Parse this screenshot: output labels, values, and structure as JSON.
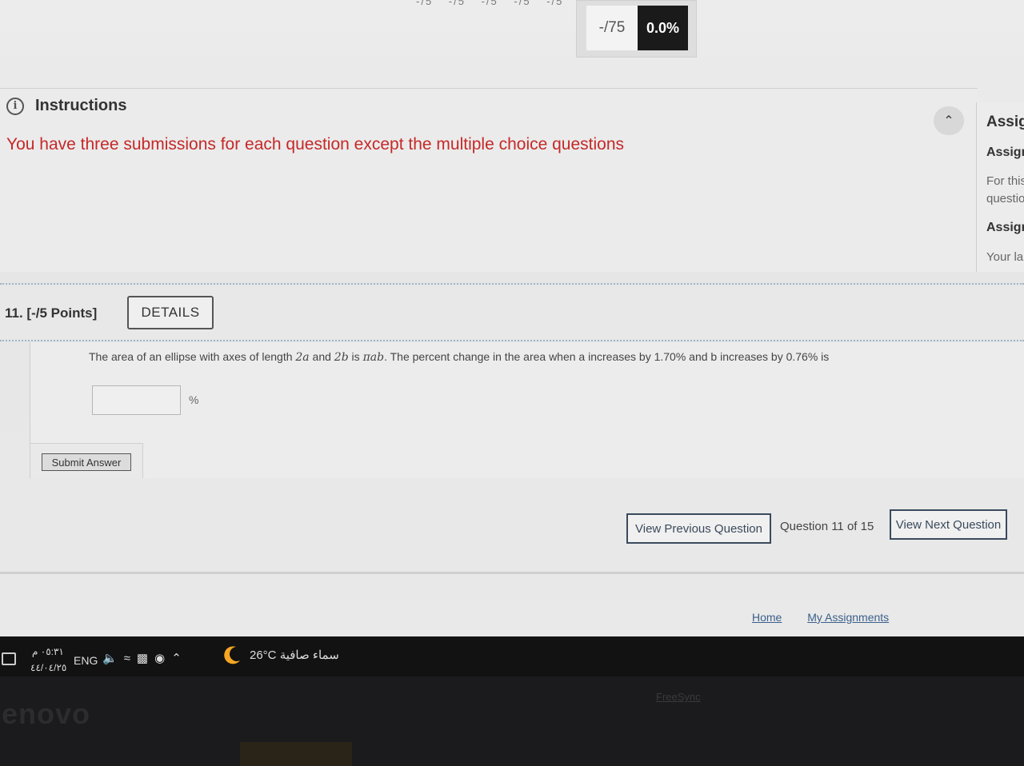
{
  "score": {
    "points": "-/75",
    "percent": "0.0%",
    "question_scores": [
      "-/5",
      "-/5",
      "-/5",
      "-/5",
      "-/5"
    ]
  },
  "instructions": {
    "title": "Instructions",
    "text": "You have three submissions for each question except the multiple choice questions"
  },
  "assignment_panel": {
    "title": "Assign",
    "heading1": "Assign",
    "text1": "For this",
    "text2": "questio",
    "heading2": "Assign",
    "text3": "Your la"
  },
  "question": {
    "header": "11.  [-/5 Points]",
    "details_label": "DETAILS",
    "text_part1": "The area of an ellipse with axes of length ",
    "math1": "2a",
    "text_part2": " and ",
    "math2": "2b",
    "text_part3": " is ",
    "math3": "πab",
    "text_part4": ".  The percent change in the area when a increases by  1.70% and b increases by 0.76% is",
    "answer_value": "",
    "unit": "%",
    "submit_label": "Submit Answer"
  },
  "navigation": {
    "prev_label": "View Previous Question",
    "count_label": "Question 11 of 15",
    "next_label": "View Next Question"
  },
  "footer": {
    "home": "Home",
    "my_assignments": "My Assignments"
  },
  "taskbar": {
    "time": "٠٥:٣١ م",
    "date": "٤٤/٠٤/٢٥",
    "language": "ENG",
    "temperature": "26°C",
    "weather_text": "سماء صافية"
  },
  "bezel": {
    "brand": "enovo",
    "freesync": "FreeSync"
  },
  "colors": {
    "instruction_text": "#c62828",
    "accent": "#3a4a5c",
    "score_dark": "#1a1a1a"
  }
}
